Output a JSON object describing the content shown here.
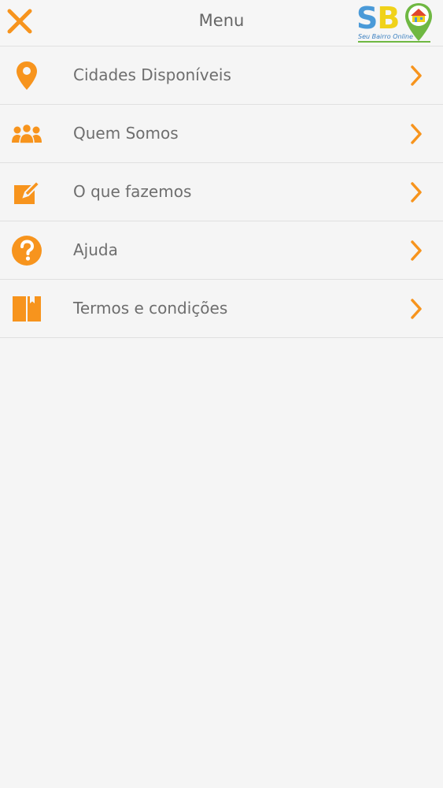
{
  "header": {
    "title": "Menu",
    "close_icon": "close-icon",
    "logo": {
      "letter_s": "S",
      "letter_b": "B",
      "tagline": "Seu Bairro Online"
    }
  },
  "menu": {
    "items": [
      {
        "label": "Cidades Disponíveis",
        "icon": "location-pin-icon"
      },
      {
        "label": "Quem Somos",
        "icon": "people-group-icon"
      },
      {
        "label": "O que fazemos",
        "icon": "edit-note-icon"
      },
      {
        "label": "Ajuda",
        "icon": "help-circle-icon"
      },
      {
        "label": "Termos e condições",
        "icon": "book-icon"
      }
    ]
  },
  "colors": {
    "accent": "#f7941d",
    "text": "#6e6e6e",
    "background": "#f5f5f5",
    "divider": "#e0e0e0"
  }
}
